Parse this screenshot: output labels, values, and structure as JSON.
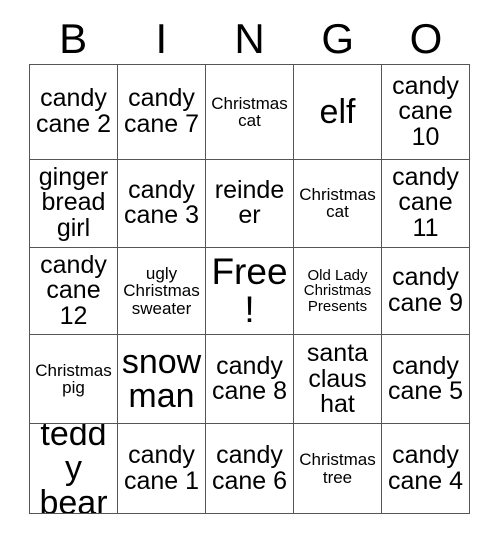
{
  "card": {
    "title": "BINGO",
    "headers": [
      "B",
      "I",
      "N",
      "G",
      "O"
    ],
    "free_space": "Free!",
    "colors": {
      "background": "#ffffff",
      "text": "#000000",
      "grid_line": "#555555"
    },
    "rows": [
      [
        {
          "text": "candy cane 2",
          "size": "md"
        },
        {
          "text": "candy cane 7",
          "size": "md"
        },
        {
          "text": "Christmas cat",
          "size": "sm"
        },
        {
          "text": "elf",
          "size": "lg"
        },
        {
          "text": "candy cane 10",
          "size": "md"
        }
      ],
      [
        {
          "text": "ginger bread girl",
          "size": "md"
        },
        {
          "text": "candy cane 3",
          "size": "md"
        },
        {
          "text": "reindeer",
          "size": "md"
        },
        {
          "text": "Christmas cat",
          "size": "sm"
        },
        {
          "text": "candy cane 11",
          "size": "md"
        }
      ],
      [
        {
          "text": "candy cane 12",
          "size": "md"
        },
        {
          "text": "ugly Christmas sweater",
          "size": "sm"
        },
        {
          "text": "Free!",
          "size": "xl"
        },
        {
          "text": "Old Lady Christmas Presents",
          "size": "xs"
        },
        {
          "text": "candy cane 9",
          "size": "md"
        }
      ],
      [
        {
          "text": "Christmas pig",
          "size": "sm"
        },
        {
          "text": "snow man",
          "size": "lg"
        },
        {
          "text": "candy cane 8",
          "size": "md"
        },
        {
          "text": "santa claus hat",
          "size": "md"
        },
        {
          "text": "candy cane 5",
          "size": "md"
        }
      ],
      [
        {
          "text": "teddy bear",
          "size": "lg"
        },
        {
          "text": "candy cane 1",
          "size": "md"
        },
        {
          "text": "candy cane 6",
          "size": "md"
        },
        {
          "text": "Christmas tree",
          "size": "sm"
        },
        {
          "text": "candy cane 4",
          "size": "md"
        }
      ]
    ]
  }
}
